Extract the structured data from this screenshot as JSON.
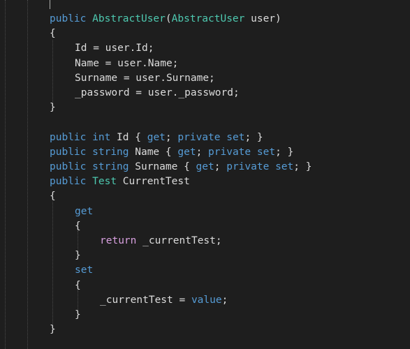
{
  "theme": {
    "background": "#1e1e1e",
    "text": "#dcdcdc",
    "keyword": "#569cd6",
    "type": "#4ec9b0",
    "control": "#d8a0df",
    "guide": "#4a4a4a"
  },
  "code": {
    "lines": [
      {
        "indent": 0,
        "tokens": [
          {
            "t": "kw",
            "v": "public"
          },
          {
            "t": "plain",
            "v": " "
          },
          {
            "t": "type",
            "v": "AbstractUser"
          },
          {
            "t": "plain",
            "v": "("
          },
          {
            "t": "type",
            "v": "AbstractUser"
          },
          {
            "t": "plain",
            "v": " user)"
          }
        ]
      },
      {
        "indent": 0,
        "tokens": [
          {
            "t": "plain",
            "v": "{"
          }
        ]
      },
      {
        "indent": 1,
        "tokens": [
          {
            "t": "plain",
            "v": "Id = user.Id;"
          }
        ]
      },
      {
        "indent": 1,
        "tokens": [
          {
            "t": "plain",
            "v": "Name = user.Name;"
          }
        ]
      },
      {
        "indent": 1,
        "tokens": [
          {
            "t": "plain",
            "v": "Surname = user.Surname;"
          }
        ]
      },
      {
        "indent": 1,
        "tokens": [
          {
            "t": "plain",
            "v": "_password = user._password;"
          }
        ]
      },
      {
        "indent": 0,
        "tokens": [
          {
            "t": "plain",
            "v": "}"
          }
        ]
      },
      {
        "indent": 0,
        "tokens": []
      },
      {
        "indent": 0,
        "tokens": [
          {
            "t": "kw",
            "v": "public"
          },
          {
            "t": "plain",
            "v": " "
          },
          {
            "t": "kw",
            "v": "int"
          },
          {
            "t": "plain",
            "v": " Id { "
          },
          {
            "t": "kw",
            "v": "get"
          },
          {
            "t": "plain",
            "v": "; "
          },
          {
            "t": "kw",
            "v": "private"
          },
          {
            "t": "plain",
            "v": " "
          },
          {
            "t": "kw",
            "v": "set"
          },
          {
            "t": "plain",
            "v": "; }"
          }
        ]
      },
      {
        "indent": 0,
        "tokens": [
          {
            "t": "kw",
            "v": "public"
          },
          {
            "t": "plain",
            "v": " "
          },
          {
            "t": "kw",
            "v": "string"
          },
          {
            "t": "plain",
            "v": " Name { "
          },
          {
            "t": "kw",
            "v": "get"
          },
          {
            "t": "plain",
            "v": "; "
          },
          {
            "t": "kw",
            "v": "private"
          },
          {
            "t": "plain",
            "v": " "
          },
          {
            "t": "kw",
            "v": "set"
          },
          {
            "t": "plain",
            "v": "; }"
          }
        ]
      },
      {
        "indent": 0,
        "tokens": [
          {
            "t": "kw",
            "v": "public"
          },
          {
            "t": "plain",
            "v": " "
          },
          {
            "t": "kw",
            "v": "string"
          },
          {
            "t": "plain",
            "v": " Surname { "
          },
          {
            "t": "kw",
            "v": "get"
          },
          {
            "t": "plain",
            "v": "; "
          },
          {
            "t": "kw",
            "v": "private"
          },
          {
            "t": "plain",
            "v": " "
          },
          {
            "t": "kw",
            "v": "set"
          },
          {
            "t": "plain",
            "v": "; }"
          }
        ]
      },
      {
        "indent": 0,
        "tokens": [
          {
            "t": "kw",
            "v": "public"
          },
          {
            "t": "plain",
            "v": " "
          },
          {
            "t": "type",
            "v": "Test"
          },
          {
            "t": "plain",
            "v": " CurrentTest"
          }
        ]
      },
      {
        "indent": 0,
        "tokens": [
          {
            "t": "plain",
            "v": "{"
          }
        ]
      },
      {
        "indent": 1,
        "tokens": [
          {
            "t": "kw",
            "v": "get"
          }
        ]
      },
      {
        "indent": 1,
        "tokens": [
          {
            "t": "plain",
            "v": "{"
          }
        ]
      },
      {
        "indent": 2,
        "tokens": [
          {
            "t": "ctl",
            "v": "return"
          },
          {
            "t": "plain",
            "v": " _currentTest;"
          }
        ]
      },
      {
        "indent": 1,
        "tokens": [
          {
            "t": "plain",
            "v": "}"
          }
        ]
      },
      {
        "indent": 1,
        "tokens": [
          {
            "t": "kw",
            "v": "set"
          }
        ]
      },
      {
        "indent": 1,
        "tokens": [
          {
            "t": "plain",
            "v": "{"
          }
        ]
      },
      {
        "indent": 2,
        "tokens": [
          {
            "t": "plain",
            "v": "_currentTest = "
          },
          {
            "t": "kw",
            "v": "value"
          },
          {
            "t": "plain",
            "v": ";"
          }
        ]
      },
      {
        "indent": 1,
        "tokens": [
          {
            "t": "plain",
            "v": "}"
          }
        ]
      },
      {
        "indent": 0,
        "tokens": [
          {
            "t": "plain",
            "v": "}"
          }
        ]
      }
    ]
  }
}
